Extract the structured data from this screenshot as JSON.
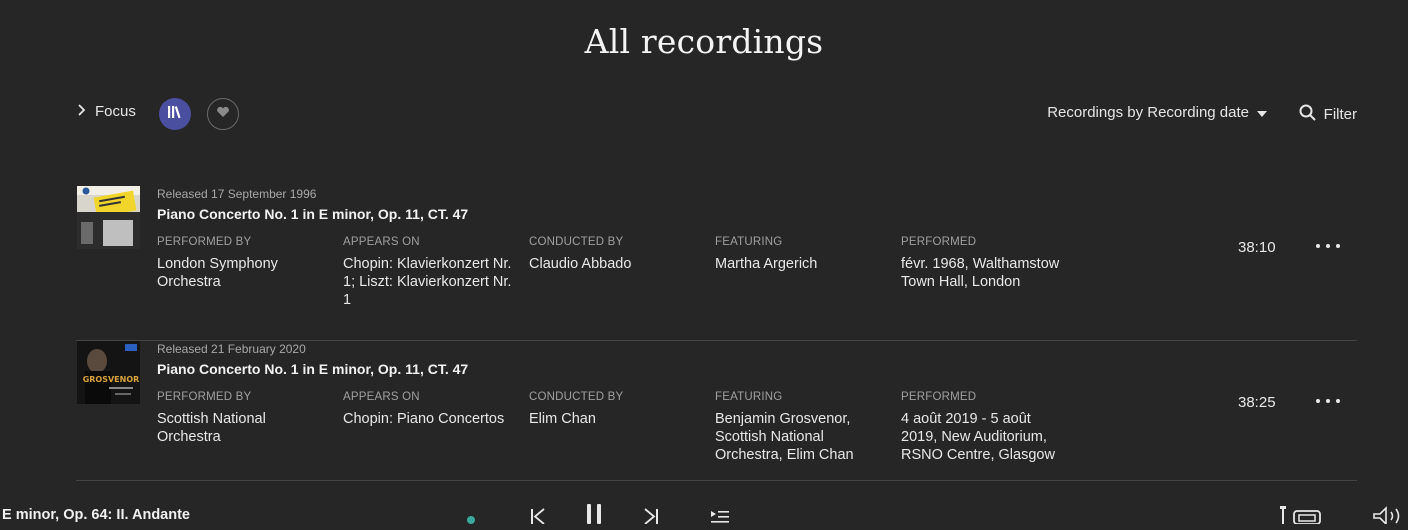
{
  "header": {
    "title": "All recordings"
  },
  "toolbar": {
    "focus_label": "Focus",
    "sort_label": "Recordings by Recording date",
    "filter_label": "Filter"
  },
  "recordings": [
    {
      "release": "Released 17 September 1996",
      "title": "Piano Concerto No. 1 in E minor, Op. 11, CT. 47",
      "performed_by_label": "PERFORMED BY",
      "performed_by": "London Symphony Orchestra",
      "appears_on_label": "APPEARS ON",
      "appears_on": "Chopin: Klavierkonzert Nr. 1; Liszt: Klavierkonzert Nr. 1",
      "conducted_by_label": "CONDUCTED BY",
      "conducted_by": "Claudio Abbado",
      "featuring_label": "FEATURING",
      "featuring": "Martha Argerich",
      "performed_label": "PERFORMED",
      "performed": "févr. 1968, Walthamstow Town Hall, London",
      "duration": "38:10"
    },
    {
      "release": "Released 21 February 2020",
      "title": "Piano Concerto No. 1 in E minor, Op. 11, CT. 47",
      "performed_by_label": "PERFORMED BY",
      "performed_by": "Scottish National Orchestra",
      "appears_on_label": "APPEARS ON",
      "appears_on": "Chopin: Piano Concertos",
      "conducted_by_label": "CONDUCTED BY",
      "conducted_by": "Elim Chan",
      "featuring_label": "FEATURING",
      "featuring": "Benjamin Grosvenor, Scottish National Orchestra, Elim Chan",
      "performed_label": "PERFORMED",
      "performed": "4 août 2019 - 5 août 2019, New Auditorium, RSNO Centre, Glasgow",
      "duration": "38:25",
      "cover_text": "GROSVENOR"
    }
  ],
  "player": {
    "now_playing": "E minor, Op. 64: II. Andante"
  },
  "colors": {
    "background": "#262626",
    "accent": "#4b4fa0",
    "indicator": "#3aa89a"
  }
}
